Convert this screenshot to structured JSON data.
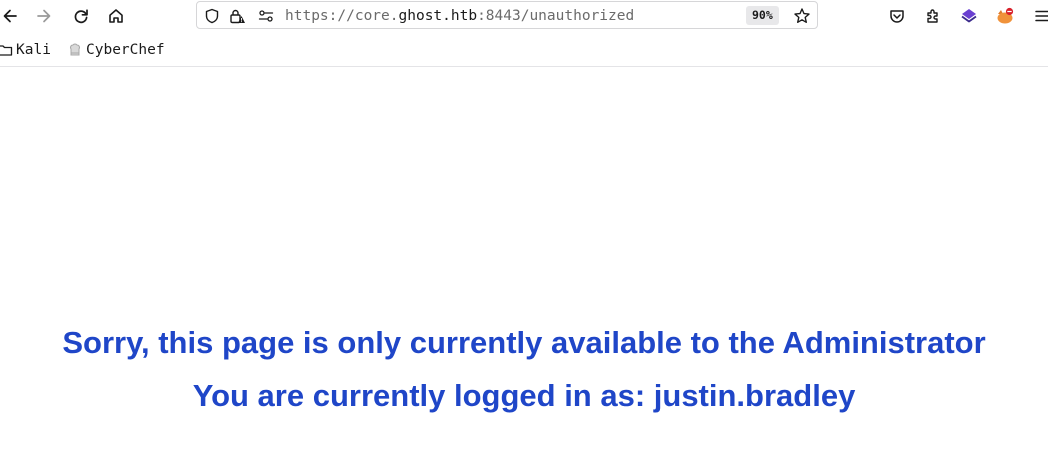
{
  "toolbar": {
    "back_icon": "arrow-left-icon",
    "forward_icon": "arrow-right-icon",
    "reload_icon": "reload-icon",
    "home_icon": "home-icon",
    "url": {
      "scheme": "https://",
      "subdomain": "core.",
      "host": "ghost.htb",
      "port_path": ":8443/unauthorized"
    },
    "zoom": "90%",
    "right_icons": [
      "pocket-icon",
      "extensions-icon",
      "purple-extension-icon",
      "foxyproxy-icon",
      "menu-icon"
    ]
  },
  "bookmarks": [
    {
      "label": "Kali",
      "icon": "folder-icon"
    },
    {
      "label": "CyberChef",
      "icon": "cyberchef-icon"
    }
  ],
  "page": {
    "message_line1": "Sorry, this page is only currently available to the Administrator",
    "message_line2": "You are currently logged in as: justin.bradley"
  },
  "colors": {
    "message": "#1f46c8",
    "background": "#ffffff"
  }
}
